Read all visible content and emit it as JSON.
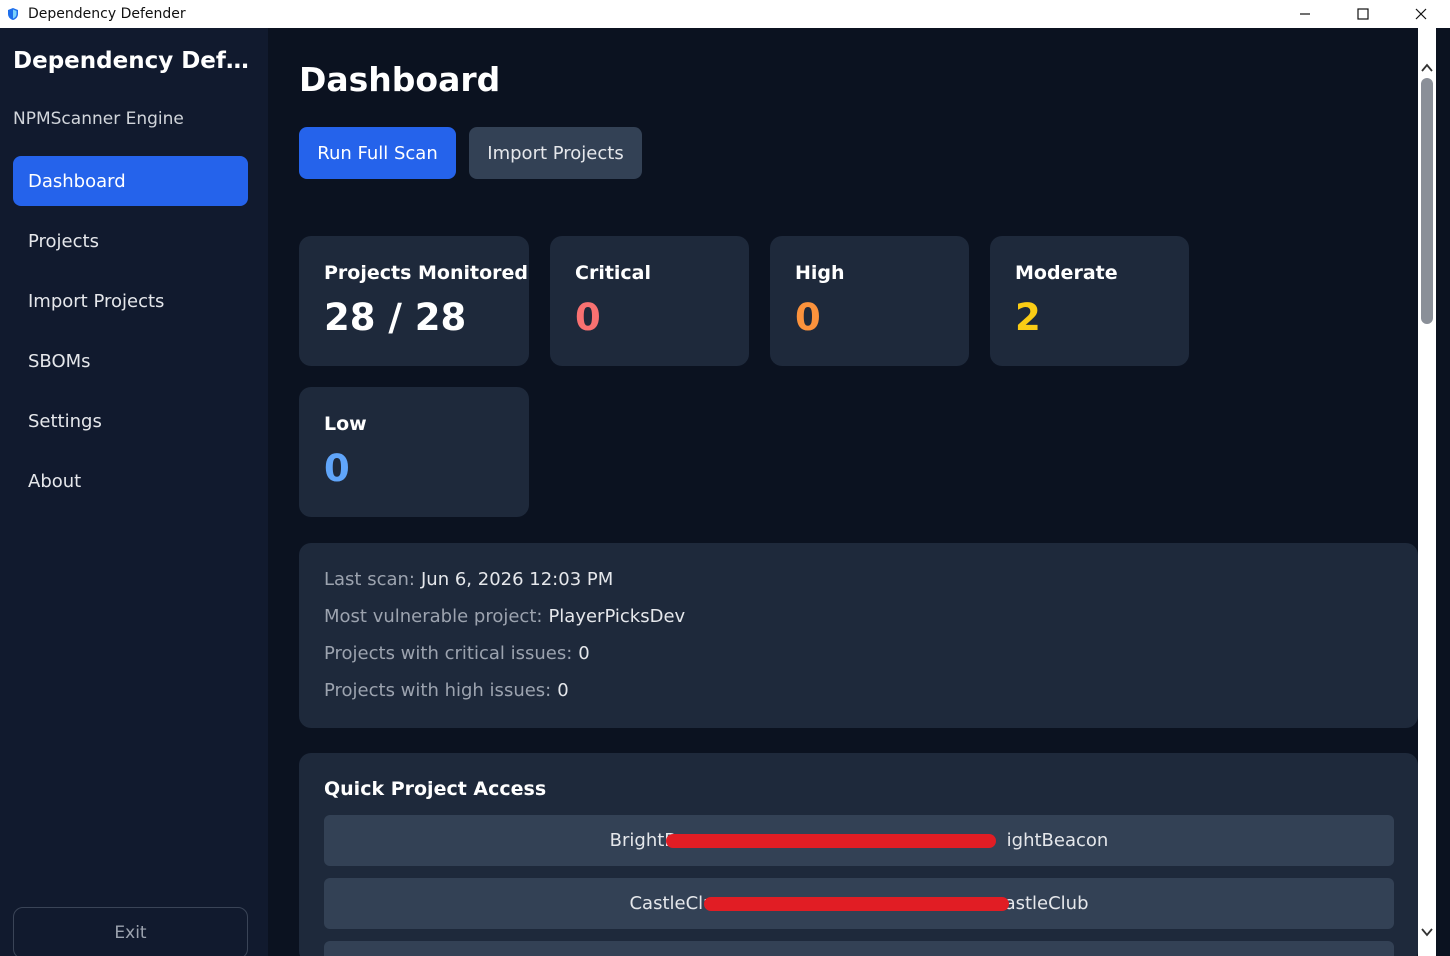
{
  "window": {
    "title": "Dependency Defender"
  },
  "sidebar": {
    "brand": "Dependency Defe...",
    "engine": "NPMScanner Engine",
    "items": [
      {
        "label": "Dashboard",
        "active": true
      },
      {
        "label": "Projects"
      },
      {
        "label": "Import Projects"
      },
      {
        "label": "SBOMs"
      },
      {
        "label": "Settings"
      },
      {
        "label": "About"
      }
    ],
    "exit_label": "Exit"
  },
  "main": {
    "title": "Dashboard",
    "run_scan_label": "Run Full Scan",
    "import_label": "Import Projects",
    "stats": {
      "monitored": {
        "label": "Projects Monitored",
        "value": "28 / 28"
      },
      "critical": {
        "label": "Critical",
        "value": "0",
        "color": "#f87171"
      },
      "high": {
        "label": "High",
        "value": "0",
        "color": "#fb923c"
      },
      "moderate": {
        "label": "Moderate",
        "value": "2",
        "color": "#facc15"
      },
      "low": {
        "label": "Low",
        "value": "0",
        "color": "#60a5fa"
      }
    },
    "summary": {
      "last_scan": {
        "label": "Last scan:",
        "value": "Jun 6, 2026 12:03 PM"
      },
      "most_vulnerable": {
        "label": "Most vulnerable project:",
        "value": "PlayerPicksDev"
      },
      "critical_projects": {
        "label": "Projects with critical issues:",
        "value": "0"
      },
      "high_projects": {
        "label": "Projects with high issues:",
        "value": "0"
      }
    },
    "quick_access": {
      "title": "Quick Project Access",
      "items": [
        {
          "label_start": "BrightB",
          "label_end": "ightBeacon"
        },
        {
          "label_start": "CastleClu",
          "label_end": "astleClub"
        }
      ]
    }
  },
  "colors": {
    "accent": "#2563eb",
    "card": "#1e293b",
    "background": "#0b1220",
    "sidebar": "#111a2e"
  }
}
